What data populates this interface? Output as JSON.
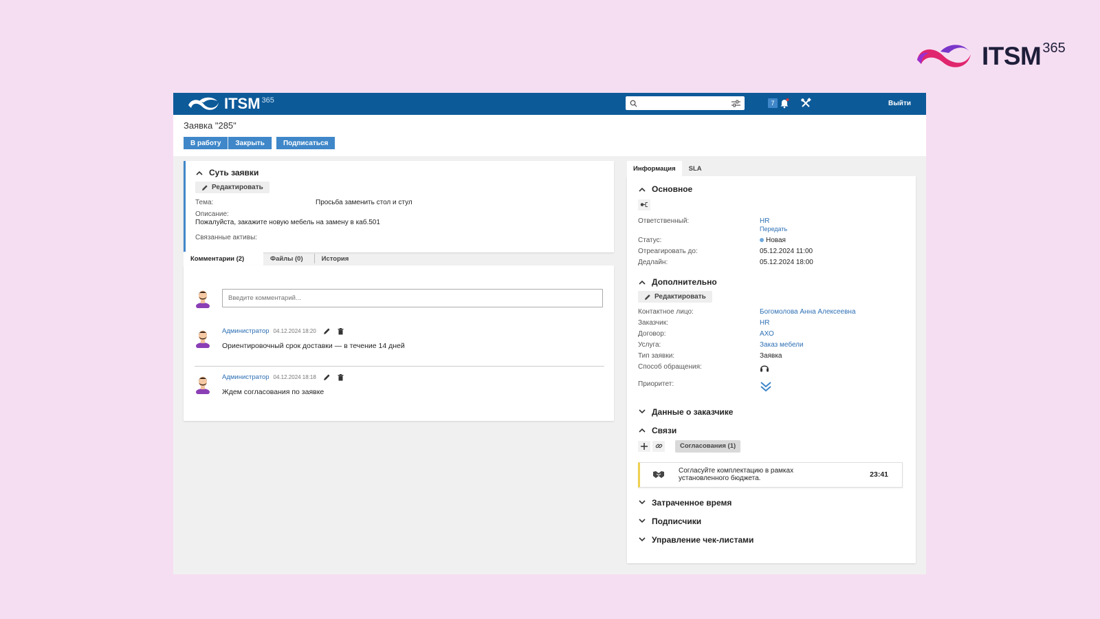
{
  "brand": {
    "name": "ITSM",
    "sup": "365"
  },
  "app": {
    "logo_text": "ITSM",
    "logo_sup": "365",
    "search_placeholder": "",
    "notifications_count": "7",
    "logout_label": "Выйти"
  },
  "page": {
    "title": "Заявка \"285\"",
    "actions": [
      "В работу",
      "Закрыть",
      "Подписаться"
    ]
  },
  "summary": {
    "heading": "Суть заявки",
    "edit_label": "Редактировать",
    "topic_label": "Тема:",
    "topic_value": "Просьба заменить стол и стул",
    "description_label": "Описание:",
    "description_value": "Пожалуйста, закажите новую мебель на замену в каб.501",
    "assets_label": "Связанные активы:"
  },
  "left_tabs": [
    "Комментарии (2)",
    "Файлы (0)",
    "История"
  ],
  "comment_input_placeholder": "Введите комментарий...",
  "comments": [
    {
      "author": "Администратор",
      "date": "04.12.2024 18:20",
      "text": "Ориентировочный срок доставки — в течение 14 дней"
    },
    {
      "author": "Администратор",
      "date": "04.12.2024 18:18",
      "text": "Ждем согласования по заявке"
    }
  ],
  "right_tabs": [
    "Информация",
    "SLA"
  ],
  "basic": {
    "heading": "Основное",
    "responsible_label": "Ответственный:",
    "responsible_value": "HR",
    "transfer_label": "Передать",
    "status_label": "Статус:",
    "status_value": "Новая",
    "respond_label": "Отреагировать до:",
    "respond_value": "05.12.2024 11:00",
    "deadline_label": "Дедлайн:",
    "deadline_value": "05.12.2024 18:00"
  },
  "extra": {
    "heading": "Дополнительно",
    "edit_label": "Редактировать",
    "contact_label": "Контактное лицо:",
    "contact_value": "Богомолова Анна Алексеевна",
    "customer_label": "Заказчик:",
    "customer_value": "HR",
    "contract_label": "Договор:",
    "contract_value": "АХО",
    "service_label": "Услуга:",
    "service_value": "Заказ мебели",
    "type_label": "Тип заявки:",
    "type_value": "Заявка",
    "channel_label": "Способ обращения:",
    "channel_icon": "headset-icon",
    "priority_label": "Приоритет:",
    "priority_icon": "double-chevron-down-icon"
  },
  "customer_data": {
    "heading": "Данные о заказчике"
  },
  "links": {
    "heading": "Связи",
    "approvals_label": "Согласования (1)",
    "task_text": "Согласуйте комплектацию в рамках установленного бюджета.",
    "task_time": "23:41"
  },
  "collapsed_sections": [
    "Затраченное время",
    "Подписчики",
    "Управление чек-листами"
  ],
  "colors": {
    "background": "#f6def2",
    "topbar": "#0d5a99",
    "accent": "#3f87c9",
    "link": "#2d6fb4",
    "approval_stripe": "#f0d050"
  }
}
